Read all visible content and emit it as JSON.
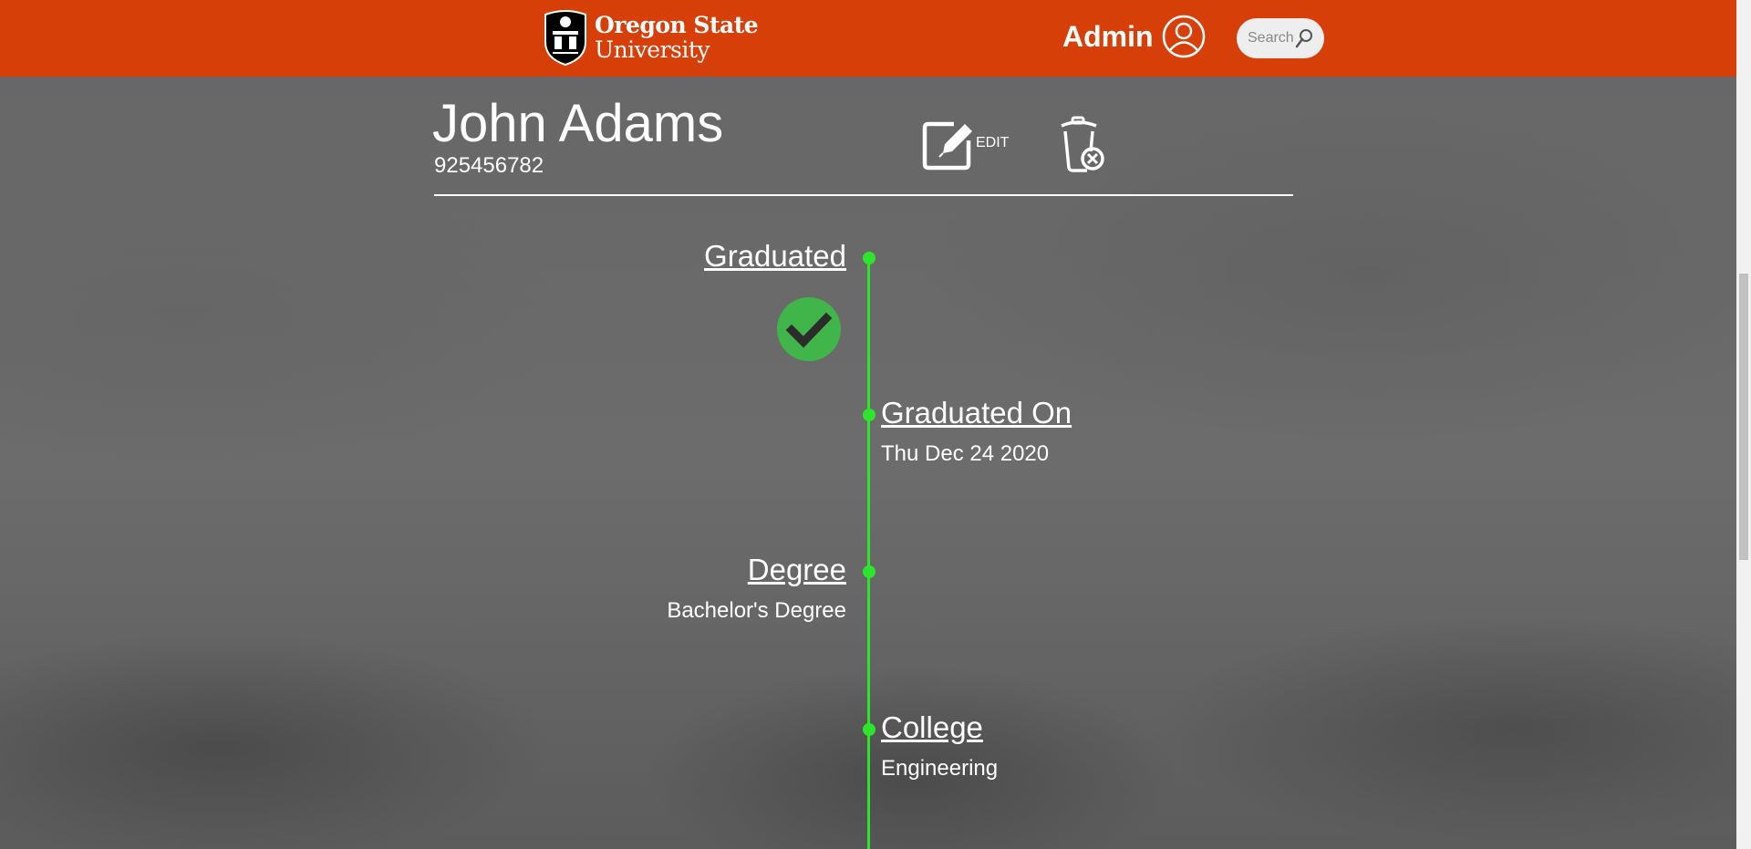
{
  "header": {
    "logo_line1": "Oregon State",
    "logo_line2": "University",
    "user_label": "Admin",
    "search_placeholder": "Search"
  },
  "student": {
    "name": "John Adams",
    "id": "925456782"
  },
  "actions": {
    "edit_label": "EDIT"
  },
  "timeline": {
    "graduated": {
      "title": "Graduated",
      "status": "check"
    },
    "graduated_on": {
      "title": "Graduated On",
      "value": "Thu Dec 24 2020"
    },
    "degree": {
      "title": "Degree",
      "value": "Bachelor's Degree"
    },
    "college": {
      "title": "College",
      "value": "Engineering"
    }
  },
  "colors": {
    "brand": "#d73f09",
    "timeline": "#2ee52e",
    "check": "#3fb54a"
  },
  "icons": [
    "osu-seal-icon",
    "user-icon",
    "search-icon",
    "edit-icon",
    "trash-delete-icon",
    "check-circle-icon"
  ]
}
